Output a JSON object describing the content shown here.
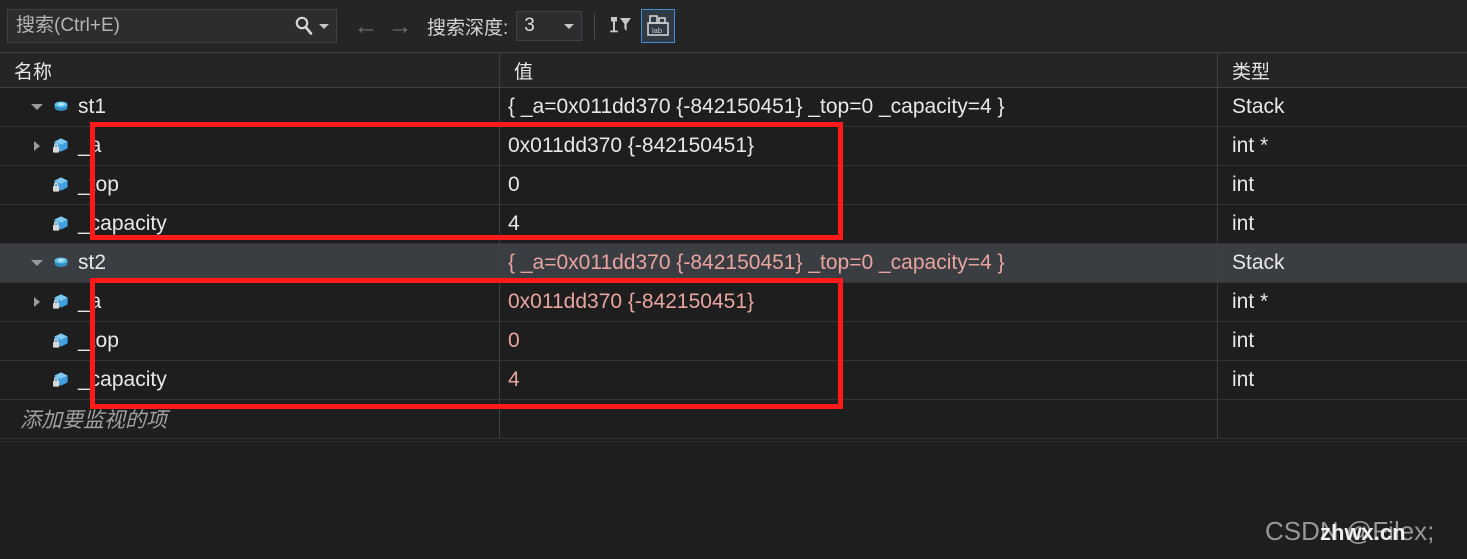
{
  "toolbar": {
    "search_placeholder": "搜索(Ctrl+E)",
    "search_value": "",
    "search_icon": "magnifier-icon",
    "search_dropdown_icon": "chevron-down-icon",
    "nav_back_icon": "arrow-left-icon",
    "nav_forward_icon": "arrow-right-icon",
    "nav_back_glyph": "←",
    "nav_forward_glyph": "→",
    "depth_label": "搜索深度:",
    "depth_value": "3",
    "pin_filter_icon": "pin-filter-icon",
    "hex_toggle_icon": "hexadecimal-display-icon",
    "accent_color": "#3f8fd8"
  },
  "grid": {
    "columns": [
      "名称",
      "值",
      "类型"
    ],
    "changed_value_color": "#e8a5a0",
    "selected_row_color": "#3a3d41",
    "rows": [
      {
        "name": "st1",
        "value": "{ _a=0x011dd370 {-842150451} _top=0 _capacity=4 }",
        "type": "Stack",
        "level": 0,
        "expander": "expanded",
        "icon": "local-variable-icon",
        "changed": false,
        "selected": false
      },
      {
        "name": "_a",
        "value": "0x011dd370 {-842150451}",
        "type": "int *",
        "level": 1,
        "expander": "collapsed",
        "icon": "private-field-icon",
        "changed": false,
        "selected": false
      },
      {
        "name": "_top",
        "value": "0",
        "type": "int",
        "level": 1,
        "expander": "none",
        "icon": "private-field-icon",
        "changed": false,
        "selected": false
      },
      {
        "name": "_capacity",
        "value": "4",
        "type": "int",
        "level": 1,
        "expander": "none",
        "icon": "private-field-icon",
        "changed": false,
        "selected": false
      },
      {
        "name": "st2",
        "value": "{ _a=0x011dd370 {-842150451} _top=0 _capacity=4 }",
        "type": "Stack",
        "level": 0,
        "expander": "expanded",
        "icon": "local-variable-icon",
        "changed": true,
        "selected": true
      },
      {
        "name": "_a",
        "value": "0x011dd370 {-842150451}",
        "type": "int *",
        "level": 1,
        "expander": "collapsed",
        "icon": "private-field-icon",
        "changed": true,
        "selected": false
      },
      {
        "name": "_top",
        "value": "0",
        "type": "int",
        "level": 1,
        "expander": "none",
        "icon": "private-field-icon",
        "changed": true,
        "selected": false
      },
      {
        "name": "_capacity",
        "value": "4",
        "type": "int",
        "level": 1,
        "expander": "none",
        "icon": "private-field-icon",
        "changed": true,
        "selected": false
      }
    ],
    "add_watch_placeholder": "添加要监视的项"
  },
  "annotations": {
    "rect_color": "#ff1a1a",
    "count": 2
  },
  "watermarks": {
    "csdn": "CSDN @Filex;",
    "site": "zhwx.cn"
  }
}
